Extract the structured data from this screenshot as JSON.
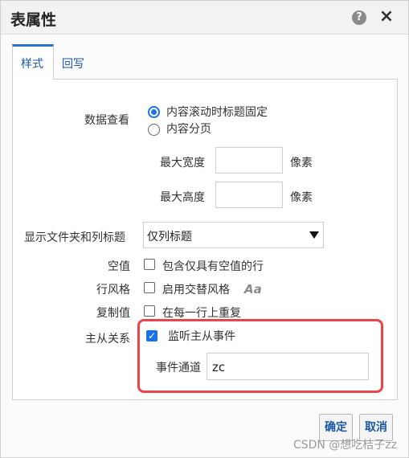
{
  "dialog": {
    "title": "表属性",
    "help_icon": "?",
    "close_icon": "×"
  },
  "tabs": [
    {
      "label": "样式",
      "active": true
    },
    {
      "label": "回写",
      "active": false
    }
  ],
  "data_view": {
    "label": "数据查看",
    "options": [
      {
        "label": "内容滚动时标题固定",
        "checked": true
      },
      {
        "label": "内容分页",
        "checked": false
      }
    ],
    "max_width_label": "最大宽度",
    "max_width_value": "",
    "max_width_unit": "像素",
    "max_height_label": "最大高度",
    "max_height_value": "",
    "max_height_unit": "像素"
  },
  "folder_headers": {
    "label": "显示文件夹和列标题",
    "selected": "仅列标题"
  },
  "null_values": {
    "label": "空值",
    "checkbox_label": "包含仅具有空值的行",
    "checked": false
  },
  "row_style": {
    "label": "行风格",
    "checkbox_label": "启用交替风格",
    "checked": false,
    "icon": "Aa"
  },
  "repeat_values": {
    "label": "复制值",
    "checkbox_label": "在每一行上重复",
    "checked": false
  },
  "master_detail": {
    "label": "主从关系",
    "checkbox_label": "监听主从事件",
    "checked": true,
    "channel_label": "事件通道",
    "channel_value": "zc",
    "highlight_color": "#e8454a"
  },
  "buttons": {
    "ok": "确定",
    "cancel": "取消"
  },
  "watermark": "CSDN @想吃桔子zz"
}
